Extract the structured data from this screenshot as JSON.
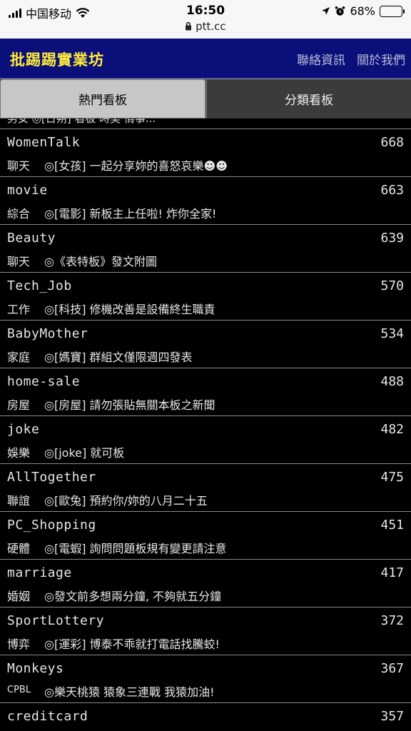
{
  "status_bar": {
    "carrier": "中国移动",
    "time": "16:50",
    "url": "ptt.cc",
    "battery": "68%",
    "battery_level": 0.68
  },
  "header": {
    "brand": "批踢踢實業坊",
    "nav": [
      "聯絡資訊",
      "關於我們"
    ]
  },
  "tabs": [
    {
      "label": "熱門看板",
      "active": true
    },
    {
      "label": "分類看板",
      "active": false
    }
  ],
  "partial_row_text": "男女 ◎[日朔] 看板 時美 情事...",
  "boards": [
    {
      "name": "WomenTalk",
      "count": "668",
      "class": "聊天",
      "title": "◎[女孩] 一起分享妳的喜怒哀樂☻☻"
    },
    {
      "name": "movie",
      "count": "663",
      "class": "綜合",
      "title": "◎[電影] 新板主上任啦! 炸你全家!"
    },
    {
      "name": "Beauty",
      "count": "639",
      "class": "聊天",
      "title": "◎《表特板》發文附圖"
    },
    {
      "name": "Tech_Job",
      "count": "570",
      "class": "工作",
      "title": "◎[科技] 修機改善是設備終生職責"
    },
    {
      "name": "BabyMother",
      "count": "534",
      "class": "家庭",
      "title": "◎[媽寶] 群組文僅限週四發表"
    },
    {
      "name": "home-sale",
      "count": "488",
      "class": "房屋",
      "title": "◎[房屋] 請勿張貼無關本板之新聞"
    },
    {
      "name": "joke",
      "count": "482",
      "class": "娛樂",
      "title": "◎[joke] 就可板"
    },
    {
      "name": "AllTogether",
      "count": "475",
      "class": "聯誼",
      "title": "◎[歐兔] 預約你/妳的八月二十五"
    },
    {
      "name": "PC_Shopping",
      "count": "451",
      "class": "硬體",
      "title": "◎[電蝦] 詢問問題板規有變更請注意"
    },
    {
      "name": "marriage",
      "count": "417",
      "class": "婚姻",
      "title": "◎發文前多想兩分鐘, 不夠就五分鐘"
    },
    {
      "name": "SportLottery",
      "count": "372",
      "class": "博弈",
      "title": "◎[運彩] 博泰不乖就打電話找騰蛟!"
    },
    {
      "name": "Monkeys",
      "count": "367",
      "class": "CPBL",
      "title": "◎樂天桃猿 猿象三連戰 我猿加油!"
    },
    {
      "name": "creditcard",
      "count": "357",
      "class": "",
      "title": ""
    }
  ]
}
